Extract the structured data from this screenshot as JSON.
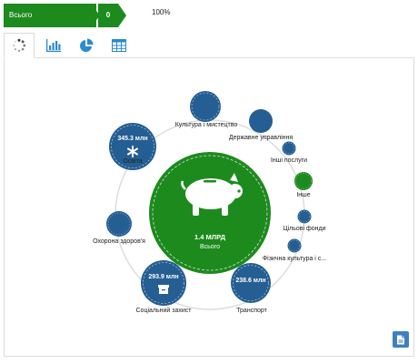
{
  "top_bar": {
    "label": "Всього",
    "count": "0",
    "percent": "100%"
  },
  "tabs": [
    {
      "name": "bubbles",
      "icon": "dotted-circle-icon",
      "active": true
    },
    {
      "name": "bar-chart",
      "icon": "bar-chart-icon",
      "active": false
    },
    {
      "name": "pie-chart",
      "icon": "pie-chart-icon",
      "active": false
    },
    {
      "name": "table",
      "icon": "table-icon",
      "active": false
    }
  ],
  "colors": {
    "green": "#1d8a1d",
    "blue": "#245e93",
    "ring": "#dddddd"
  },
  "center": {
    "value": "1.4 МЛРД",
    "label": "Всього",
    "icon": "piggy-bank-icon"
  },
  "bubbles": [
    {
      "id": "kultura",
      "label": "Культура і мистецтво",
      "value": ""
    },
    {
      "id": "derzhavne",
      "label": "Державне управління",
      "value": ""
    },
    {
      "id": "inshi-posluhy",
      "label": "Інші послуги",
      "value": ""
    },
    {
      "id": "inshe",
      "label": "Інше",
      "value": ""
    },
    {
      "id": "tsilovi-fondy",
      "label": "Цільові фонди",
      "value": ""
    },
    {
      "id": "fizychna",
      "label": "Фізична культура і с...",
      "value": ""
    },
    {
      "id": "transport",
      "label": "Транспорт",
      "value": "238.6 млн"
    },
    {
      "id": "sotsialnyi",
      "label": "Соціальний захист",
      "value": "293.9 млн"
    },
    {
      "id": "okhorona",
      "label": "Охорона здоров'я",
      "value": ""
    },
    {
      "id": "osvita",
      "label": "Освіта",
      "value": "345.3 млн"
    }
  ],
  "export_button": {
    "icon": "export-document-icon"
  }
}
